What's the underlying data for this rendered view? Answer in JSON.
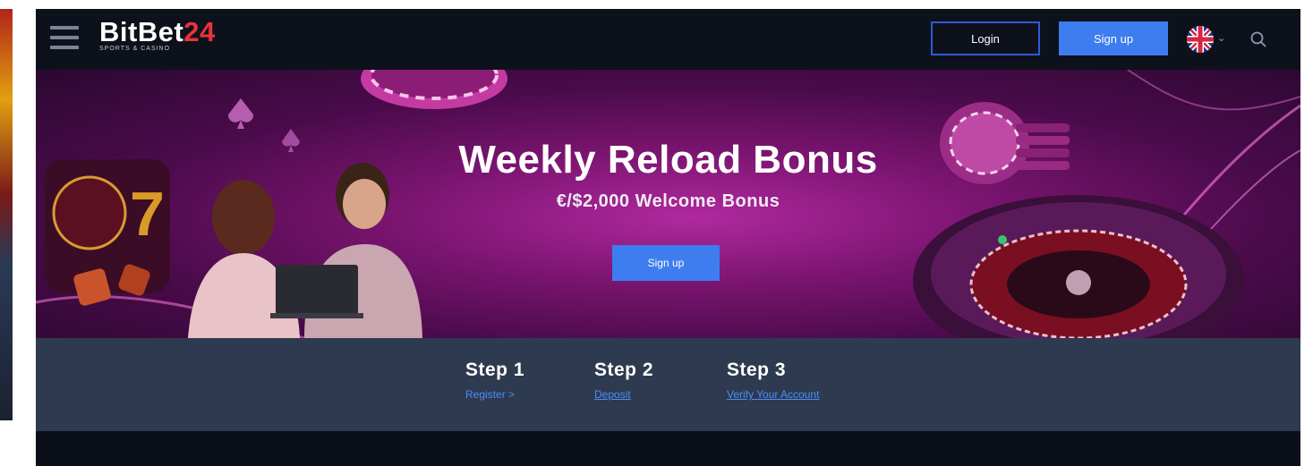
{
  "header": {
    "logo_main": "BitBet",
    "logo_num": "24",
    "logo_tag": "SPORTS & CASINO",
    "login_label": "Login",
    "signup_label": "Sign up",
    "language_icon": "uk-flag-icon",
    "search_icon": "search-icon"
  },
  "hero": {
    "title": "Weekly Reload Bonus",
    "subtitle": "€/$2,000 Welcome Bonus",
    "button_label": "Sign up"
  },
  "steps": [
    {
      "title": "Step 1",
      "link": "Register >"
    },
    {
      "title": "Step 2",
      "link": "Deposit"
    },
    {
      "title": "Step 3",
      "link": "Verify Your Account"
    }
  ],
  "colors": {
    "accent_blue": "#3d7df0",
    "brand_red": "#e8343a",
    "header_bg": "#0d111c",
    "steps_bg": "#2e3a50"
  }
}
